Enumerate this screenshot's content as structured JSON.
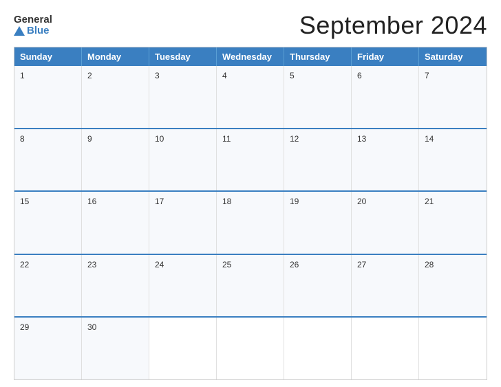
{
  "header": {
    "logo": {
      "general": "General",
      "blue": "Blue"
    },
    "title": "September 2024"
  },
  "calendar": {
    "day_headers": [
      "Sunday",
      "Monday",
      "Tuesday",
      "Wednesday",
      "Thursday",
      "Friday",
      "Saturday"
    ],
    "weeks": [
      [
        {
          "day": 1,
          "empty": false
        },
        {
          "day": 2,
          "empty": false
        },
        {
          "day": 3,
          "empty": false
        },
        {
          "day": 4,
          "empty": false
        },
        {
          "day": 5,
          "empty": false
        },
        {
          "day": 6,
          "empty": false
        },
        {
          "day": 7,
          "empty": false
        }
      ],
      [
        {
          "day": 8,
          "empty": false
        },
        {
          "day": 9,
          "empty": false
        },
        {
          "day": 10,
          "empty": false
        },
        {
          "day": 11,
          "empty": false
        },
        {
          "day": 12,
          "empty": false
        },
        {
          "day": 13,
          "empty": false
        },
        {
          "day": 14,
          "empty": false
        }
      ],
      [
        {
          "day": 15,
          "empty": false
        },
        {
          "day": 16,
          "empty": false
        },
        {
          "day": 17,
          "empty": false
        },
        {
          "day": 18,
          "empty": false
        },
        {
          "day": 19,
          "empty": false
        },
        {
          "day": 20,
          "empty": false
        },
        {
          "day": 21,
          "empty": false
        }
      ],
      [
        {
          "day": 22,
          "empty": false
        },
        {
          "day": 23,
          "empty": false
        },
        {
          "day": 24,
          "empty": false
        },
        {
          "day": 25,
          "empty": false
        },
        {
          "day": 26,
          "empty": false
        },
        {
          "day": 27,
          "empty": false
        },
        {
          "day": 28,
          "empty": false
        }
      ],
      [
        {
          "day": 29,
          "empty": false
        },
        {
          "day": 30,
          "empty": false
        },
        {
          "day": "",
          "empty": true
        },
        {
          "day": "",
          "empty": true
        },
        {
          "day": "",
          "empty": true
        },
        {
          "day": "",
          "empty": true
        },
        {
          "day": "",
          "empty": true
        }
      ]
    ]
  },
  "colors": {
    "header_bg": "#3a7fc1",
    "accent": "#3a7fc1",
    "cell_bg": "#f7f9fc",
    "text": "#333333",
    "white": "#ffffff"
  }
}
